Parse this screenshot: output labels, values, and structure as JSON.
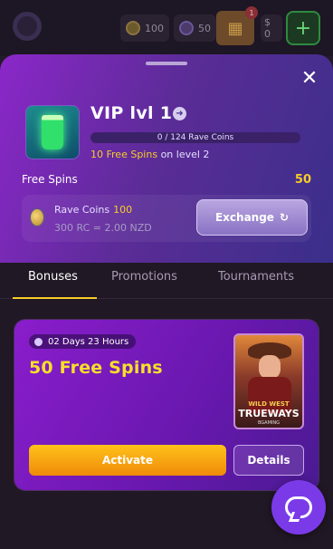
{
  "topbar": {
    "coins_gold": "100",
    "coins_purple": "50",
    "gift_badge": "1",
    "balance": "$ 0",
    "add_icon": "plus-icon"
  },
  "vip": {
    "title": "VIP lvl 1",
    "progress_text": "0 / 124 Rave Coins",
    "progress_fraction": 0,
    "level_bonus": "10 Free Spins",
    "level_suffix": "on level 2",
    "free_spins_label": "Free Spins",
    "free_spins_value": "50",
    "rave_coins_label": "Rave Coins",
    "rave_coins_value": "100",
    "rate": "300 RC = 2.00 NZD",
    "exchange_label": "Exchange"
  },
  "tabs": [
    {
      "label": "Bonuses",
      "active": true
    },
    {
      "label": "Promotions",
      "active": false
    },
    {
      "label": "Tournaments",
      "active": false
    }
  ],
  "bonus": {
    "timer": "02 Days 23 Hours",
    "title": "50 Free Spins",
    "game_line1": "WILD WEST",
    "game_line2": "TRUEWAYS",
    "game_line3": "BGAMING",
    "activate_label": "Activate",
    "details_label": "Details"
  },
  "colors": {
    "accent_gold": "#f6cc2a",
    "vip_purple": "#8b27c9",
    "chat_purple": "#7b3ae8"
  }
}
